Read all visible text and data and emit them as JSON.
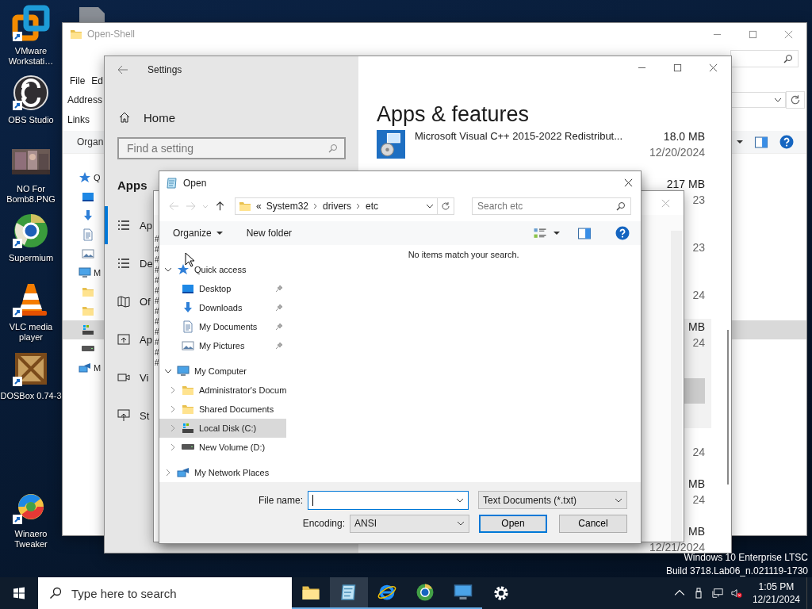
{
  "desktop_icons": [
    {
      "kind": "vmware",
      "label": "VMware Workstati…"
    },
    {
      "kind": "obs",
      "label": "OBS Studio"
    },
    {
      "kind": "picture",
      "label": "NO For Bomb8.PNG"
    },
    {
      "kind": "supermium",
      "label": "Supermium"
    },
    {
      "kind": "vlc",
      "label": "VLC media player"
    },
    {
      "kind": "dosbox",
      "label": "DOSBox 0.74-3"
    },
    {
      "kind": "winaero",
      "label": "Winaero Tweaker"
    }
  ],
  "explorer": {
    "title": "Open-Shell",
    "menu": [
      "File",
      "Ed"
    ],
    "address_label": "Address",
    "links_label": "Links",
    "toolbar_label": "Organ",
    "tree": [
      {
        "kind": "star",
        "label": "Q",
        "selected": false,
        "children": [
          {
            "kind": "desktop",
            "selected": false
          },
          {
            "kind": "download",
            "selected": false
          },
          {
            "kind": "document",
            "selected": false
          },
          {
            "kind": "pictures",
            "selected": false
          }
        ]
      },
      {
        "kind": "computer",
        "label": "M",
        "selected": false,
        "children": [
          {
            "kind": "folder",
            "selected": false
          },
          {
            "kind": "folder",
            "selected": false
          },
          {
            "kind": "system-drive",
            "selected": true
          },
          {
            "kind": "drive",
            "selected": false
          }
        ]
      },
      {
        "kind": "network",
        "label": "M",
        "selected": false
      }
    ]
  },
  "settings": {
    "title": "Settings",
    "home": "Home",
    "search_placeholder": "Find a setting",
    "section": "Apps",
    "nav": [
      {
        "kind": "list",
        "label": "Ap",
        "selected": true
      },
      {
        "kind": "defaults",
        "label": "De",
        "selected": false
      },
      {
        "kind": "map",
        "label": "Of",
        "selected": false
      },
      {
        "kind": "websites",
        "label": "Ap",
        "selected": false
      },
      {
        "kind": "video",
        "label": "Vi",
        "selected": false
      },
      {
        "kind": "startup",
        "label": "St",
        "selected": false
      }
    ],
    "heading": "Apps & features",
    "apps": [
      {
        "name": "Microsoft Visual C++ 2015-2022 Redistribut...",
        "size": "18.0 MB",
        "date": "12/20/2024",
        "selected": false
      },
      {
        "size": "217 MB",
        "date": "23",
        "selected": false
      },
      {
        "date": "23",
        "selected": false
      },
      {
        "date": "24",
        "selected": false
      },
      {
        "size": "MB",
        "date": "24",
        "selected": true
      },
      {
        "date": "24",
        "selected": false
      },
      {
        "size": "MB",
        "date": "24",
        "selected": false
      },
      {
        "size": "MB",
        "date": "12/21/2024",
        "selected": false
      }
    ]
  },
  "background_window": {
    "lines": [
      "#",
      "#",
      "#",
      "#",
      "#",
      "#",
      "#",
      "#",
      "#",
      "#",
      "#",
      "#",
      "#"
    ]
  },
  "open_dialog": {
    "title": "Open",
    "path_overflow": "«",
    "path": [
      "System32",
      "drivers",
      "etc"
    ],
    "search_placeholder": "Search etc",
    "organize": "Organize",
    "new_folder": "New folder",
    "empty_message": "No items match your search.",
    "tree": [
      {
        "kind": "star",
        "label": "Quick access",
        "expanded": true,
        "selected": false,
        "children": [
          {
            "kind": "desktop",
            "label": "Desktop",
            "pinned": true,
            "selected": false
          },
          {
            "kind": "download",
            "label": "Downloads",
            "pinned": true,
            "selected": false
          },
          {
            "kind": "document",
            "label": "My Documents",
            "pinned": true,
            "selected": false
          },
          {
            "kind": "pictures",
            "label": "My Pictures",
            "pinned": true,
            "selected": false
          }
        ]
      },
      {
        "kind": "computer",
        "label": "My Computer",
        "expanded": true,
        "selected": false,
        "children": [
          {
            "kind": "folder",
            "label": "Administrator's Docum",
            "expanded": false,
            "selected": false
          },
          {
            "kind": "folder",
            "label": "Shared Documents",
            "expanded": false,
            "selected": false
          },
          {
            "kind": "system-drive",
            "label": "Local Disk (C:)",
            "expanded": false,
            "selected": true
          },
          {
            "kind": "drive",
            "label": "New Volume (D:)",
            "expanded": false,
            "selected": false
          }
        ]
      },
      {
        "kind": "network",
        "label": "My Network Places",
        "expanded": false,
        "selected": false
      }
    ],
    "file_name_label": "File name:",
    "file_type": "Text Documents (*.txt)",
    "encoding_label": "Encoding:",
    "encoding": "ANSI",
    "buttons": [
      {
        "label": "Open",
        "default": true
      },
      {
        "label": "Cancel",
        "default": false
      }
    ]
  },
  "system_info": [
    "Windows 10 Enterprise LTSC",
    "Build 3718.Lab06_n.021119-1730"
  ],
  "taskbar": {
    "search_placeholder": "Type here to search",
    "apps": [
      {
        "kind": "folder",
        "running": true,
        "active": false
      },
      {
        "kind": "notepad",
        "running": true,
        "active": true
      },
      {
        "kind": "ie",
        "running": true,
        "active": false
      },
      {
        "kind": "supermium",
        "running": true,
        "active": false
      },
      {
        "kind": "computer",
        "running": true,
        "active": false
      },
      {
        "kind": "gear",
        "running": false,
        "active": false
      }
    ],
    "time": "1:05 PM",
    "date": "12/21/2024"
  }
}
